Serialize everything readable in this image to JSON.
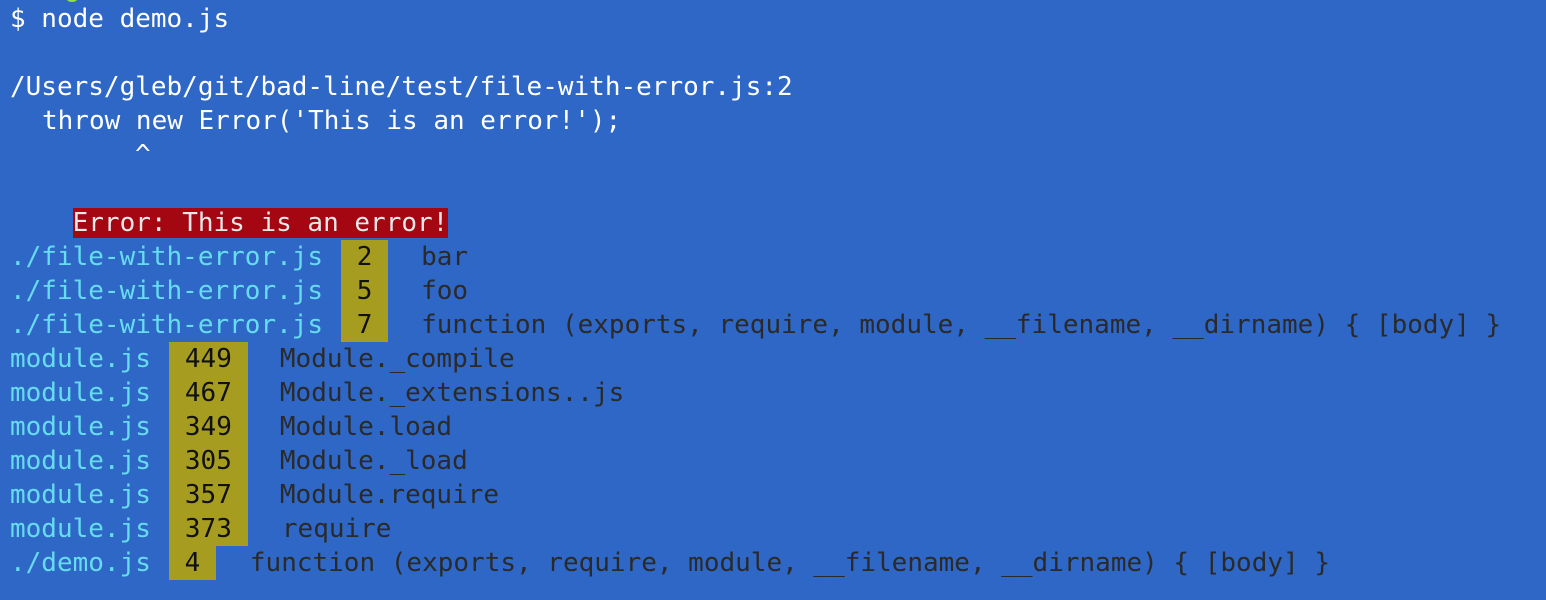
{
  "command": "$ node demo.js",
  "error_location": {
    "path": "/Users/gleb/git/bad-line/test/file-with-error.js:2",
    "code": "throw new Error('This is an error!');",
    "caret": "^"
  },
  "error_message": "Error: This is an error!",
  "stack": [
    {
      "file": "./file-with-error.js",
      "line": "2",
      "fn": "bar"
    },
    {
      "file": "./file-with-error.js",
      "line": "5",
      "fn": "foo"
    },
    {
      "file": "./file-with-error.js",
      "line": "7",
      "fn": "function (exports, require, module, __filename, __dirname) { [body] }"
    },
    {
      "file": "module.js",
      "line": "449",
      "fn": "Module._compile"
    },
    {
      "file": "module.js",
      "line": "467",
      "fn": "Module._extensions..js"
    },
    {
      "file": "module.js",
      "line": "349",
      "fn": "Module.load"
    },
    {
      "file": "module.js",
      "line": "305",
      "fn": "Module._load"
    },
    {
      "file": "module.js",
      "line": "357",
      "fn": "Module.require"
    },
    {
      "file": "module.js",
      "line": "373",
      "fn": "require"
    },
    {
      "file": "./demo.js",
      "line": "4",
      "fn": "function (exports, require, module, __filename, __dirname) { [body] }"
    }
  ],
  "colors": {
    "background": "#2f67c6",
    "file": "#66dcf0",
    "line_highlight": "#a69c1f",
    "error_highlight": "#a40612",
    "function_text": "#2a2a2a"
  }
}
